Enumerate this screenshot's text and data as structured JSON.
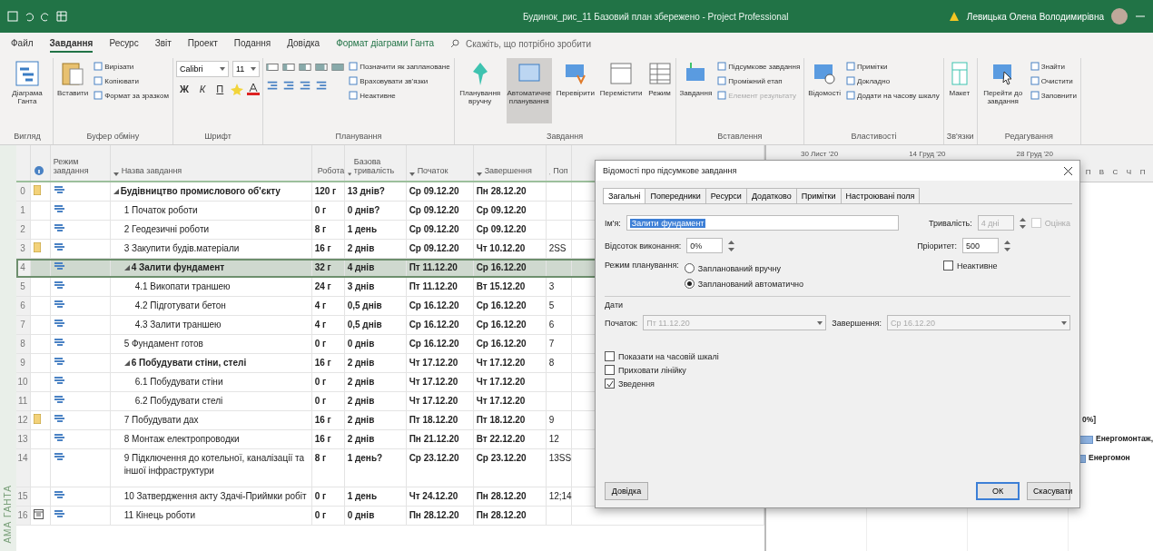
{
  "window": {
    "title": "Будинок_рис_11 Базовий план збережено - Project Professional",
    "user": "Левицька Олена Володимирівна"
  },
  "menu_tabs": [
    {
      "label": "Файл",
      "selected": false
    },
    {
      "label": "Завдання",
      "selected": true
    },
    {
      "label": "Ресурс",
      "selected": false
    },
    {
      "label": "Звіт",
      "selected": false
    },
    {
      "label": "Проект",
      "selected": false
    },
    {
      "label": "Подання",
      "selected": false
    },
    {
      "label": "Довідка",
      "selected": false
    },
    {
      "label": "Формат діаграми Ганта",
      "selected": false,
      "kind": "context"
    }
  ],
  "search": {
    "placeholder": "Скажіть, що потрібно зробити"
  },
  "ribbon": {
    "groups": [
      {
        "label": "Вигляд",
        "large": [
          {
            "label": "Діаграма Ганта",
            "selected": false
          }
        ]
      },
      {
        "label": "Буфер обміну",
        "large": [
          {
            "label": "Вставити",
            "selected": false
          }
        ],
        "small": [
          {
            "label": "Вирізати",
            "disabled": false
          },
          {
            "label": "Копіювати",
            "disabled": false
          },
          {
            "label": "Формат за зразком",
            "disabled": false
          }
        ]
      },
      {
        "label": "Шрифт",
        "kind": "font",
        "font": "Calibri",
        "size": "11",
        "format_buttons": [
          "Ж",
          "К",
          "П"
        ]
      },
      {
        "label": "Планування",
        "kind": "schedule",
        "small": [
          {
            "label": "Позначити як заплановане",
            "disabled": false
          },
          {
            "label": "Враховувати зв'язки",
            "disabled": false
          },
          {
            "label": "Неактивне",
            "disabled": false
          }
        ]
      },
      {
        "label": "Завдання",
        "large": [
          {
            "label": "Планування вручну",
            "selected": false
          },
          {
            "label": "Автоматичне планування",
            "selected": true
          },
          {
            "label": "Перевірити",
            "selected": false
          },
          {
            "label": "Перемістити",
            "selected": false
          },
          {
            "label": "Режим",
            "selected": false
          }
        ]
      },
      {
        "label": "Вставлення",
        "large": [
          {
            "label": "Завдання",
            "selected": false
          }
        ],
        "small": [
          {
            "label": "Підсумкове завдання",
            "disabled": false
          },
          {
            "label": "Проміжний етап",
            "disabled": false
          },
          {
            "label": "Елемент результату",
            "disabled": true
          }
        ]
      },
      {
        "label": "Властивості",
        "large": [
          {
            "label": "Відомості",
            "selected": false
          }
        ],
        "small": [
          {
            "label": "Примітки",
            "disabled": false
          },
          {
            "label": "Докладно",
            "disabled": false
          },
          {
            "label": "Додати на часову шкалу",
            "disabled": false
          }
        ]
      },
      {
        "label": "Зв'язки",
        "large": [
          {
            "label": "Макет",
            "selected": false
          }
        ]
      },
      {
        "label": "Редагування",
        "large": [
          {
            "label": "Перейти до завдання",
            "selected": false
          }
        ],
        "small": [
          {
            "label": "Знайти",
            "disabled": false
          },
          {
            "label": "Очистити",
            "disabled": false
          },
          {
            "label": "Заповнити",
            "disabled": false
          }
        ]
      }
    ]
  },
  "side_label": "АМА ГАНТА",
  "table": {
    "columns": [
      "Режим завдання",
      "Назва завдання",
      "Робота",
      "Базова тривалість",
      "Початок",
      "Завершення",
      "Поп"
    ],
    "rows": [
      {
        "id": "0",
        "note": true,
        "name": "Будівництво промислового об'єкту",
        "work": "120 г",
        "duration": "13 днів?",
        "start": "Ср 09.12.20",
        "finish": "Пн 28.12.20",
        "selected": false,
        "expanded": true,
        "children": [
          {
            "id": "1",
            "name": "1 Початок роботи",
            "work": "0 г",
            "duration": "0 днів?",
            "start": "Ср 09.12.20",
            "finish": "Ср 09.12.20",
            "selected": false
          },
          {
            "id": "2",
            "name": "2 Геодезичні роботи",
            "work": "8 г",
            "duration": "1 день",
            "start": "Ср 09.12.20",
            "finish": "Ср 09.12.20",
            "selected": false
          },
          {
            "id": "3",
            "note": true,
            "name": "3 Закупити будів.матеріали",
            "work": "16 г",
            "duration": "2 днів",
            "start": "Ср 09.12.20",
            "finish": "Чт 10.12.20",
            "pred": "2SS",
            "selected": false
          },
          {
            "id": "4",
            "name": "4 Залити фундамент",
            "work": "32 г",
            "duration": "4 днів",
            "start": "Пт 11.12.20",
            "finish": "Ср 16.12.20",
            "selected": true,
            "expanded": true,
            "children": [
              {
                "id": "5",
                "name": "4.1 Викопати траншею",
                "work": "24 г",
                "duration": "3 днів",
                "start": "Пт 11.12.20",
                "finish": "Вт 15.12.20",
                "pred": "3",
                "selected": false
              },
              {
                "id": "6",
                "name": "4.2 Підготувати бетон",
                "work": "4 г",
                "duration": "0,5 днів",
                "start": "Ср 16.12.20",
                "finish": "Ср 16.12.20",
                "pred": "5",
                "selected": false
              },
              {
                "id": "7",
                "name": "4.3 Залити траншею",
                "work": "4 г",
                "duration": "0,5 днів",
                "start": "Ср 16.12.20",
                "finish": "Ср 16.12.20",
                "pred": "6",
                "selected": false
              }
            ]
          },
          {
            "id": "8",
            "name": "5 Фундамент готов",
            "work": "0 г",
            "duration": "0 днів",
            "start": "Ср 16.12.20",
            "finish": "Ср 16.12.20",
            "pred": "7",
            "selected": false
          },
          {
            "id": "9",
            "name": "6 Побудувати стіни, стелі",
            "work": "16 г",
            "duration": "2 днів",
            "start": "Чт 17.12.20",
            "finish": "Чт 17.12.20",
            "pred": "8",
            "selected": false,
            "expanded": true,
            "children": [
              {
                "id": "10",
                "name": "6.1 Побудувати стіни",
                "work": "0 г",
                "duration": "2 днів",
                "start": "Чт 17.12.20",
                "finish": "Чт 17.12.20",
                "selected": false
              },
              {
                "id": "11",
                "name": "6.2 Побудувати стелі",
                "work": "0 г",
                "duration": "2 днів",
                "start": "Чт 17.12.20",
                "finish": "Чт 17.12.20",
                "selected": false
              }
            ]
          },
          {
            "id": "12",
            "note": true,
            "name": "7 Побудувати дах",
            "work": "16 г",
            "duration": "2 днів",
            "start": "Пт 18.12.20",
            "finish": "Пт 18.12.20",
            "pred": "9",
            "selected": false,
            "gantt": {
              "kind": "label",
              "label": "0%]"
            }
          },
          {
            "id": "13",
            "name": "8 Монтаж електропроводки",
            "work": "16 г",
            "duration": "2 днів",
            "start": "Пн 21.12.20",
            "finish": "Вт 22.12.20",
            "pred": "12",
            "selected": false,
            "gantt": {
              "kind": "bar",
              "label": "Енергомонтаж,"
            }
          },
          {
            "id": "14",
            "name": "9 Підключення до котельної, каналізації та іншої інфраструктури",
            "work": "8 г",
            "duration": "1 день?",
            "start": "Ср 23.12.20",
            "finish": "Ср 23.12.20",
            "pred": "13SS",
            "selected": false,
            "gantt": {
              "kind": "bar",
              "label": "Енергомон"
            }
          },
          {
            "id": "15",
            "name": "10 Затвердження акту Здачі-Приймки робіт",
            "work": "0 г",
            "duration": "1 день",
            "start": "Чт 24.12.20",
            "finish": "Пн 28.12.20",
            "pred": "12;14",
            "selected": false
          },
          {
            "id": "16",
            "calendar": true,
            "name": "11 Кінець роботи",
            "work": "0 г",
            "duration": "0 днів",
            "start": "Пн 28.12.20",
            "finish": "Пн 28.12.20",
            "selected": false
          }
        ]
      }
    ]
  },
  "gantt": {
    "weeks": [
      "30 Лист '20",
      "14 Груд '20",
      "28 Груд '20"
    ],
    "days": [
      "П",
      "В",
      "С",
      "Ч",
      "П"
    ]
  },
  "dialog": {
    "title": "Відомості про підсумкове завдання",
    "tabs": [
      {
        "label": "Загальні",
        "selected": true
      },
      {
        "label": "Попередники",
        "selected": false
      },
      {
        "label": "Ресурси",
        "selected": false
      },
      {
        "label": "Додатково",
        "selected": false
      },
      {
        "label": "Примітки",
        "selected": false
      },
      {
        "label": "Настроювані поля",
        "selected": false
      }
    ],
    "name_label": "Ім'я:",
    "name_value": "Залити фундамент",
    "duration_label": "Тривалість:",
    "duration_value": "4 дні",
    "duration_disabled": true,
    "estimated": {
      "label": "Оцінка",
      "checked": false,
      "disabled": true
    },
    "percent_label": "Відсоток виконання:",
    "percent_value": "0%",
    "priority_label": "Пріоритет:",
    "priority_value": "500",
    "mode_label": "Режим планування:",
    "modes": [
      {
        "label": "Запланований вручну",
        "selected": false
      },
      {
        "label": "Запланований автоматично",
        "selected": true
      }
    ],
    "inactive": {
      "label": "Неактивне",
      "checked": false
    },
    "dates_label": "Дати",
    "start_label": "Початок:",
    "start_value": "Пт 11.12.20",
    "finish_label": "Завершення:",
    "finish_value": "Ср 16.12.20",
    "dates_disabled": true,
    "options": [
      {
        "label": "Показати на часовій шкалі",
        "checked": false
      },
      {
        "label": "Приховати лінійку",
        "checked": false
      },
      {
        "label": "Зведення",
        "checked": true
      }
    ],
    "buttons": [
      {
        "label": "Довідка",
        "kind": "help"
      },
      {
        "label": "ОК",
        "kind": "default"
      },
      {
        "label": "Скасувати",
        "kind": "normal"
      }
    ]
  }
}
